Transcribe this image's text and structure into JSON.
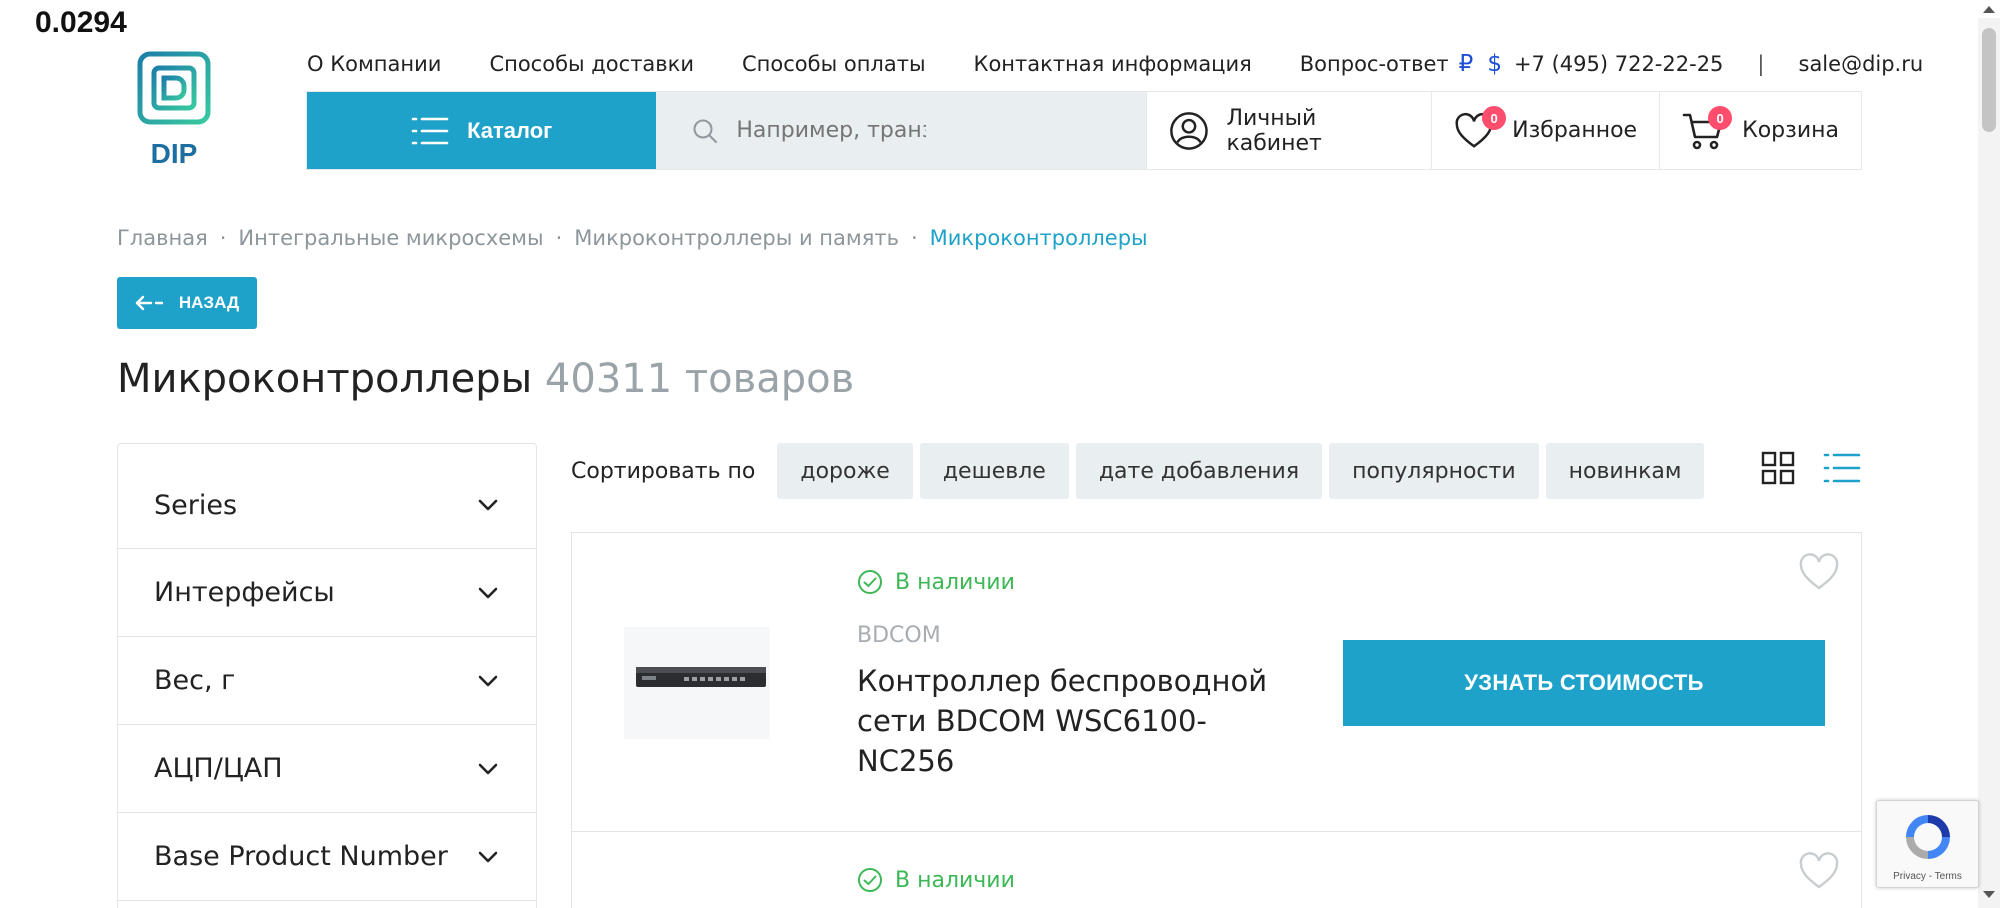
{
  "overlay_value": "0.0294",
  "logo": {
    "text": "DIP",
    "icon": "chip-logo-icon"
  },
  "topnav": {
    "links": [
      "О Компании",
      "Способы доставки",
      "Способы оплаты",
      "Контактная информация",
      "Вопрос-ответ"
    ],
    "currency_rub": "₽",
    "currency_usd": "$",
    "phone": "+7 (495) 722-22-25",
    "separator": "|",
    "email": "sale@dip.ru"
  },
  "header": {
    "catalog_label": "Каталог",
    "search_placeholder": "Например, транзи",
    "account_label": "Личный кабинет",
    "favorites_label": "Избранное",
    "favorites_count": "0",
    "cart_label": "Корзина",
    "cart_count": "0"
  },
  "breadcrumb": {
    "items": [
      "Главная",
      "Интегральные микросхемы",
      "Микроконтроллеры и память",
      "Микроконтроллеры"
    ],
    "separator": "·"
  },
  "back_label": "НАЗАД",
  "page": {
    "title": "Микроконтроллеры",
    "count": "40311 товаров"
  },
  "filters": [
    "Series",
    "Интерфейсы",
    "Вес, г",
    "АЦП/ЦАП",
    "Base Product Number"
  ],
  "sort": {
    "label": "Сортировать по",
    "options": [
      "дороже",
      "дешевле",
      "дате добавления",
      "популярности",
      "новинкам"
    ]
  },
  "products": [
    {
      "stock": "В наличии",
      "brand": "BDCOM",
      "name": "Контроллер беспроводной сети BDCOM WSC6100-NC256",
      "button": "УЗНАТЬ СТОИМОСТЬ"
    },
    {
      "stock": "В наличии"
    }
  ],
  "recaptcha": {
    "text": "Privacy - Terms"
  },
  "colors": {
    "accent": "#1fa2c9",
    "stock": "#3db856",
    "badge": "#ff4d6d",
    "currency": "#1d4fd6"
  }
}
